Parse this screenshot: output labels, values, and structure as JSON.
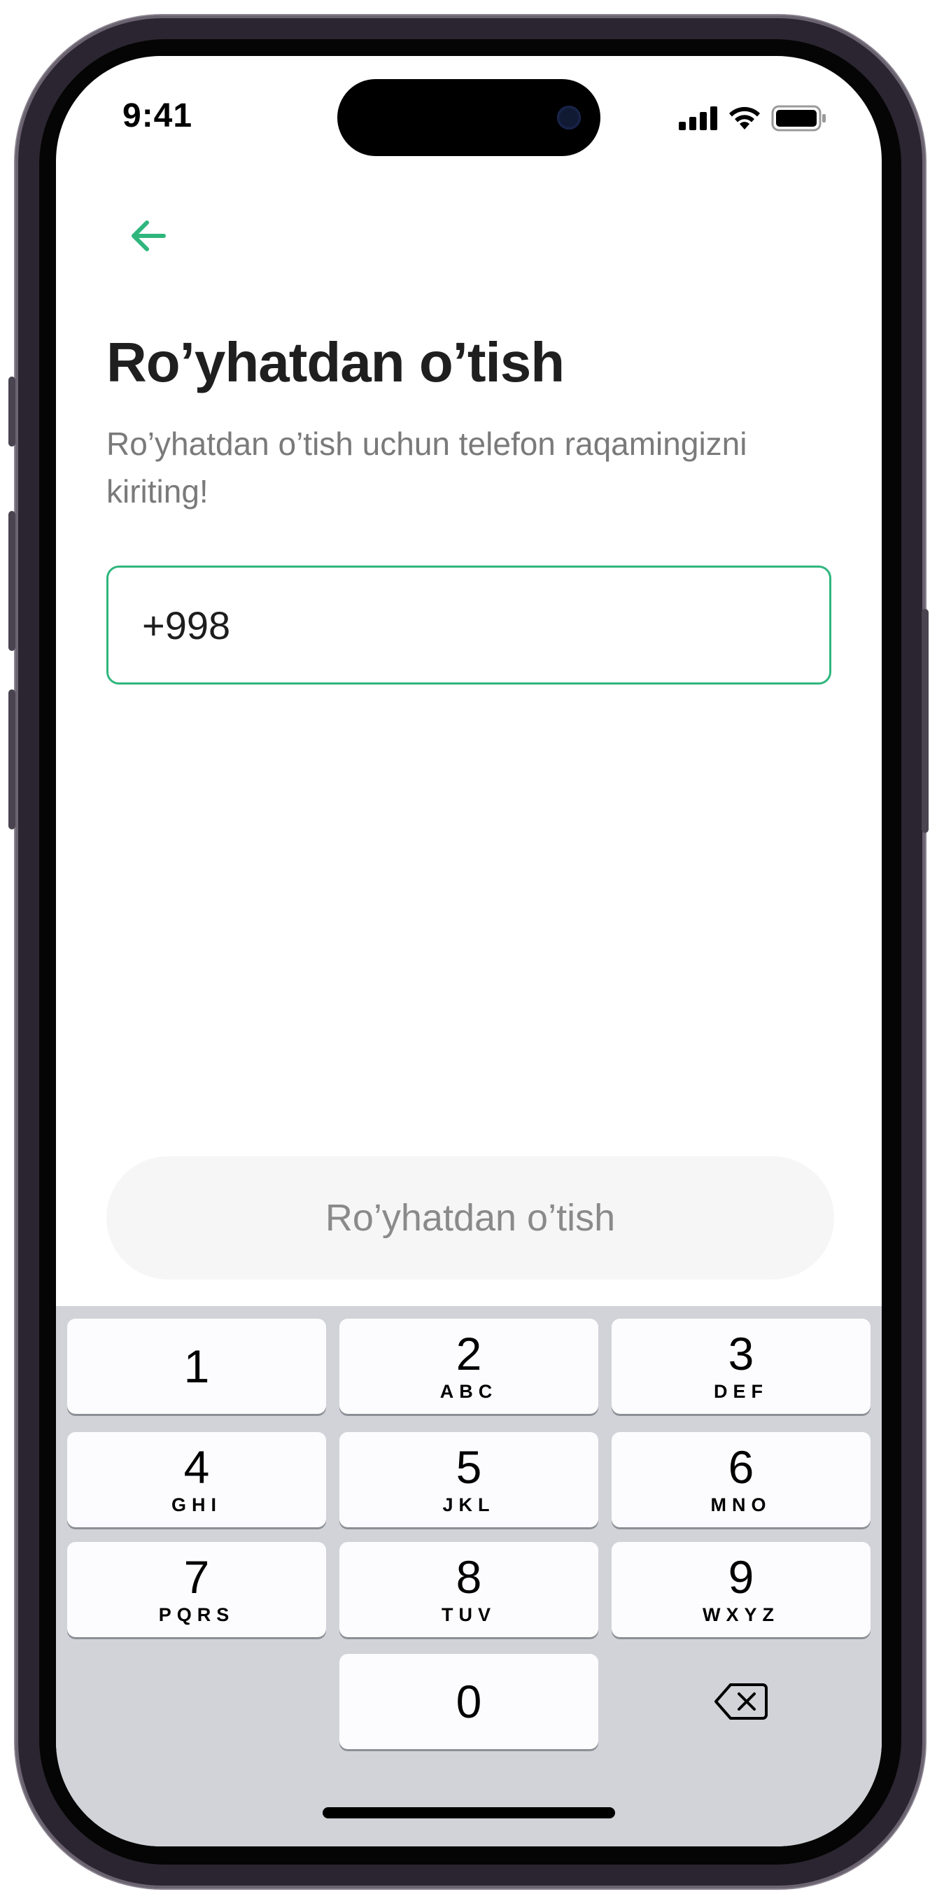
{
  "status_bar": {
    "time": "9:41",
    "icons": [
      "cellular-signal-icon",
      "wifi-icon",
      "battery-icon"
    ]
  },
  "nav": {
    "back_icon": "arrow-left-icon"
  },
  "page": {
    "title": "Ro’yhatdan o’tish",
    "subtitle": "Ro’yhatdan o’tish uchun telefon raqamingizni kiriting!"
  },
  "phone_field": {
    "value": "+998"
  },
  "submit": {
    "label": "Ro’yhatdan o’tish"
  },
  "keyboard": {
    "keys": [
      {
        "num": "1",
        "letters": ""
      },
      {
        "num": "2",
        "letters": "ABC"
      },
      {
        "num": "3",
        "letters": "DEF"
      },
      {
        "num": "4",
        "letters": "GHI"
      },
      {
        "num": "5",
        "letters": "JKL"
      },
      {
        "num": "6",
        "letters": "MNO"
      },
      {
        "num": "7",
        "letters": "PQRS"
      },
      {
        "num": "8",
        "letters": "TUV"
      },
      {
        "num": "9",
        "letters": "WXYZ"
      },
      {
        "num": "0",
        "letters": ""
      }
    ],
    "delete_icon": "backspace-icon"
  },
  "colors": {
    "accent": "#2fb67d",
    "title": "#1f1f1f",
    "subtitle": "#7a7a7a",
    "button_bg": "#f6f6f6",
    "keyboard_bg": "#d1d3d8"
  }
}
